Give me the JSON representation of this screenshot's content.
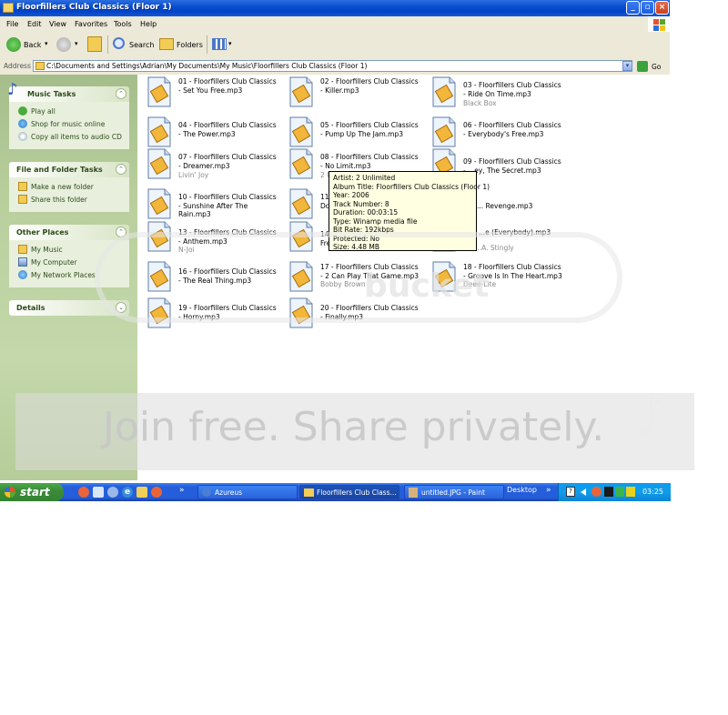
{
  "window": {
    "title": "Floorfillers Club Classics (Floor 1)"
  },
  "menu": [
    "File",
    "Edit",
    "View",
    "Favorites",
    "Tools",
    "Help"
  ],
  "toolbar": {
    "back": "Back",
    "search": "Search",
    "folders": "Folders"
  },
  "address": {
    "label": "Address",
    "path": "C:\\Documents and Settings\\Adrian\\My Documents\\My Music\\Floorfillers Club Classics (Floor 1)",
    "go": "Go"
  },
  "sidebar": {
    "music_tasks": {
      "title": "Music Tasks",
      "items": [
        "Play all",
        "Shop for music online",
        "Copy all items to audio CD"
      ]
    },
    "file_tasks": {
      "title": "File and Folder Tasks",
      "items": [
        "Make a new folder",
        "Share this folder"
      ]
    },
    "other_places": {
      "title": "Other Places",
      "items": [
        "My Music",
        "My Computer",
        "My Network Places"
      ]
    },
    "details": {
      "title": "Details"
    }
  },
  "files": [
    {
      "name": "01 - Floorfillers Club Classics - Set You Free.mp3",
      "artist": ""
    },
    {
      "name": "02 - Floorfillers Club Classics - Killer.mp3",
      "artist": ""
    },
    {
      "name": "03 - Floorfillers Club Classics - Ride On Time.mp3",
      "artist": "Black Box"
    },
    {
      "name": "04 - Floorfillers Club Classics - The Power.mp3",
      "artist": ""
    },
    {
      "name": "05 - Floorfillers Club Classics - Pump Up The Jam.mp3",
      "artist": ""
    },
    {
      "name": "06 - Floorfillers Club Classics - Everybody's Free.mp3",
      "artist": ""
    },
    {
      "name": "07 - Floorfillers Club Classics - Dreamer.mp3",
      "artist": "Livin' Joy"
    },
    {
      "name": "08 - Floorfillers Club Classics - No Limit.mp3",
      "artist": "2 U"
    },
    {
      "name": "09 - Floorfillers Club Classics - ...ey, The Secret.mp3",
      "artist": ""
    },
    {
      "name": "10 - Floorfillers Club Classics - Sunshine After The Rain.mp3",
      "artist": ""
    },
    {
      "name": "11 Dom",
      "artist": ""
    },
    {
      "name": "... Revenge.mp3",
      "artist": ""
    },
    {
      "name": "13 - Floorfillers Club Classics - Anthem.mp3",
      "artist": "N-Joi"
    },
    {
      "name": "14 Fre",
      "artist": ""
    },
    {
      "name": "...e (Everybody).mp3",
      "artist": "...A. Stingly"
    },
    {
      "name": "16 - Floorfillers Club Classics - The Real Thing.mp3",
      "artist": ""
    },
    {
      "name": "17 - Floorfillers Club Classics - 2 Can Play That Game.mp3",
      "artist": "Bobby Brown"
    },
    {
      "name": "18 - Floorfillers Club Classics - Groove Is In The Heart.mp3",
      "artist": "Deee-Lite"
    },
    {
      "name": "19 - Floorfillers Club Classics - Horny.mp3",
      "artist": ""
    },
    {
      "name": "20 - Floorfillers Club Classics - Finally.mp3",
      "artist": ""
    }
  ],
  "tooltip": {
    "artist": "Artist: 2 Unlimited",
    "album": "Album Title: Floorfillers Club Classics (Floor 1)",
    "year": "Year: 2006",
    "track": "Track Number: 8",
    "duration": "Duration: 00:03:15",
    "type": "Type: Winamp media file",
    "bitrate": "Bit Rate: 192kbps",
    "protected": "Protected: No",
    "size": "Size: 4.48 MB"
  },
  "watermark": {
    "brand": "bucket",
    "tagline": "Join free. Share privately."
  },
  "taskbar": {
    "start": "start",
    "items": [
      "Azureus",
      "Floorfillers Club Class...",
      "untitled.JPG - Paint"
    ],
    "desktop": "Desktop",
    "clock": "03:25"
  },
  "colors": {
    "title_blue": "#0a4ed0",
    "sidebar_green": "#b8cf9c",
    "tooltip_bg": "#ffffe1",
    "taskbar_blue": "#245edb",
    "start_green": "#3c8b3a"
  }
}
